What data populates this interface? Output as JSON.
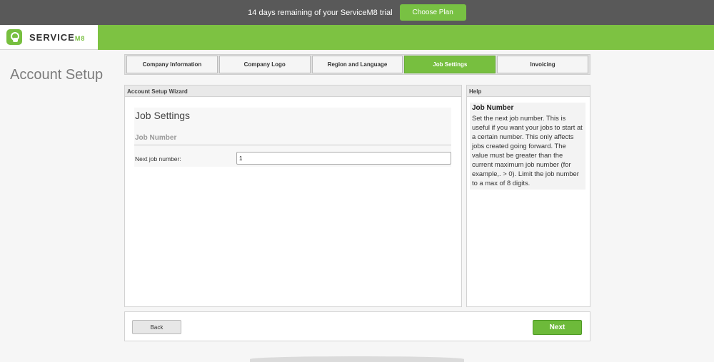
{
  "trial": {
    "message": "14 days remaining of your ServiceM8 trial",
    "cta_label": "Choose Plan"
  },
  "brand": {
    "name": "SERVICE",
    "suffix": "M8"
  },
  "page": {
    "title": "Account Setup"
  },
  "tabs": [
    {
      "label": "Company Information",
      "active": false
    },
    {
      "label": "Company Logo",
      "active": false
    },
    {
      "label": "Region and Language",
      "active": false
    },
    {
      "label": "Job Settings",
      "active": true
    },
    {
      "label": "Invoicing",
      "active": false
    }
  ],
  "wizard": {
    "header": "Account Setup Wizard",
    "section_title": "Job Settings",
    "subsection_title": "Job Number",
    "field_label": "Next job number:",
    "field_value": "1"
  },
  "help": {
    "header": "Help",
    "title": "Job Number",
    "text": "Set the next job number. This is useful if you want your jobs to start at a certain number. This only affects jobs created going forward. The value must be greater than the current maximum job number (for example,. > 0). Limit the job number to a max of 8 digits."
  },
  "footer": {
    "back_label": "Back",
    "next_label": "Next"
  },
  "colors": {
    "brand_green": "#7dc242",
    "trial_bar": "#595959"
  },
  "icons": {
    "logo": "servicem8-logo-icon"
  }
}
